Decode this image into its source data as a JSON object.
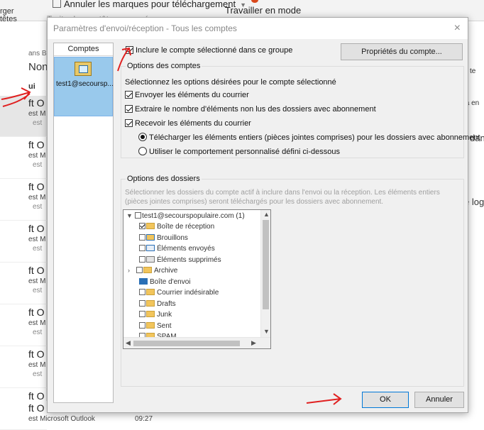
{
  "ribbon": {
    "undo_label": "Annuler les marques pour téléchargement",
    "treat_headers_label": "Traiter les en-têtes marqués",
    "work_offline_label": "Travailler en mode",
    "left_a": "rger",
    "left_b": "têtes"
  },
  "list": {
    "search_hint": "ans B",
    "col_from": "Non",
    "today": "ui",
    "items": [
      {
        "t1": "ft O",
        "t2": "est M",
        "t3": "est"
      },
      {
        "t1": "ft O",
        "t2": "est M",
        "t3": "est"
      },
      {
        "t1": "ft O",
        "t2": "est M",
        "t3": "est"
      },
      {
        "t1": "ft O",
        "t2": "est M",
        "t3": "est"
      },
      {
        "t1": "ft O",
        "t2": "est M",
        "t3": "est"
      },
      {
        "t1": "ft O",
        "t2": "est M",
        "t3": "est"
      },
      {
        "t1": "ft O",
        "t2": "est M",
        "t3": "est"
      },
      {
        "t1": "ft O",
        "t2": "est M",
        "t3": "est"
      }
    ],
    "footer": {
      "t1": "ft O",
      "sender": "est Microsoft Outlook",
      "time": "09:27"
    }
  },
  "right_pane": {
    "r1": "te",
    "r2": "k a en",
    "r3": "dans",
    "r4": "e log"
  },
  "dialog": {
    "title": "Paramètres d'envoi/réception - Tous les comptes",
    "close": "×",
    "accounts_header": "Comptes",
    "account_label": "test1@secoursp...",
    "include_label": "Inclure le compte sélectionné dans ce groupe",
    "props_button": "Propriétés du compte...",
    "account_options": {
      "legend": "Options des comptes",
      "hint": "Sélectionnez les options désirées pour le compte sélectionné",
      "send": "Envoyer les éléments du courrier",
      "count": "Extraire le nombre d'éléments non lus des dossiers avec abonnement",
      "receive": "Recevoir les éléments du courrier",
      "download_full": "Télécharger les éléments entiers (pièces jointes comprises) pour les dossiers avec abonnement",
      "custom": "Utiliser le comportement personnalisé défini ci-dessous"
    },
    "folder_options": {
      "legend": "Options des dossiers",
      "hint1": "Sélectionner les dossiers du compte actif à inclure dans l'envoi ou la réception. Les éléments entiers",
      "hint2": "(pièces jointes comprises) seront téléchargés pour les dossiers avec abonnement."
    },
    "tree": {
      "root": "test1@secourspopulaire.com (1)",
      "folders": [
        {
          "label": "Boîte de réception",
          "checked": true
        },
        {
          "label": "Brouillons",
          "checked": false
        },
        {
          "label": "Éléments envoyés",
          "checked": false
        },
        {
          "label": "Éléments supprimés",
          "checked": false
        },
        {
          "label": "Archive",
          "checked": false
        },
        {
          "label": "Boîte d'envoi",
          "checked": false
        },
        {
          "label": "Courrier indésirable",
          "checked": false
        },
        {
          "label": "Drafts",
          "checked": false
        },
        {
          "label": "Junk",
          "checked": false
        },
        {
          "label": "Sent",
          "checked": false
        },
        {
          "label": "SPAM",
          "checked": false
        }
      ]
    },
    "ok_button": "OK",
    "cancel_button": "Annuler"
  },
  "colors": {
    "annotation_red": "#e02020",
    "selection_blue": "#99c9ec"
  }
}
